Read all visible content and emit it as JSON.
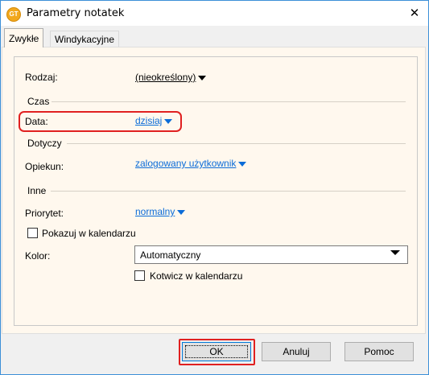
{
  "window": {
    "title": "Parametry notatek",
    "icon_name": "app-icon",
    "close_glyph": "✕"
  },
  "tabs": [
    {
      "label": "Zwykłe",
      "active": true
    },
    {
      "label": "Windykacyjne",
      "active": false
    }
  ],
  "form": {
    "rodzaj": {
      "label": "Rodzaj:",
      "value": "(nieokreślony)"
    },
    "czas_section": "Czas",
    "data": {
      "label": "Data:",
      "value": "dzisiaj"
    },
    "dotyczy_section": "Dotyczy",
    "opiekun": {
      "label": "Opiekun:",
      "value": "zalogowany użytkownik"
    },
    "inne_section": "Inne",
    "priorytet": {
      "label": "Priorytet:",
      "value": "normalny"
    },
    "pokazuj": {
      "label": "Pokazuj w kalendarzu",
      "checked": false
    },
    "kolor": {
      "label": "Kolor:",
      "value": "Automatyczny"
    },
    "kotwicz": {
      "label": "Kotwicz w kalendarzu",
      "checked": false
    }
  },
  "buttons": {
    "ok": "OK",
    "cancel": "Anuluj",
    "help": "Pomoc"
  },
  "colors": {
    "accent": "#0078d7",
    "link": "#0b6cd8",
    "highlight": "#e02020",
    "panel_bg": "#fff8ee"
  }
}
